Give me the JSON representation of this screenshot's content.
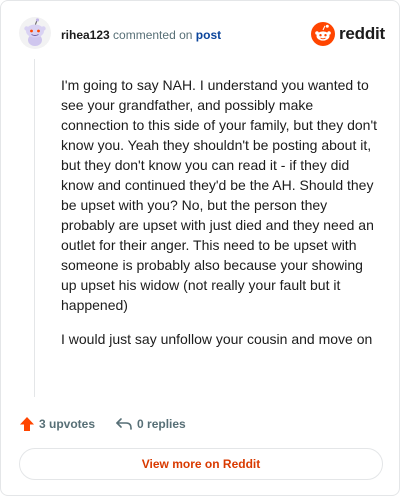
{
  "header": {
    "username": "rihea123",
    "action_text": "commented on",
    "post_link": "post"
  },
  "brand": {
    "name": "reddit",
    "accent": "#ff4500"
  },
  "comment": {
    "paragraphs": [
      "I'm going to say NAH. I understand you wanted to see your grandfather, and possibly make connection to this side of your family, but they don't know you. Yeah they shouldn't be posting about it, but they don't know you can read it - if they did know and continued they'd be the AH. Should they be upset with you? No, but the person they probably are upset with just died and they need an outlet for their anger. This need to be upset with someone is probably also because your showing up upset his widow (not really your fault but it happened)",
      "I would just say unfollow your cousin and move on"
    ]
  },
  "actions": {
    "upvotes": "3 upvotes",
    "replies": "0 replies",
    "upvote_icon": "upvote-arrow-icon",
    "reply_icon": "reply-arrow-icon"
  },
  "footer": {
    "view_more": "View more on Reddit"
  },
  "colors": {
    "upvote": "#ff4500",
    "link": "#0a449b",
    "view_more": "#d93a00",
    "muted": "#576f76"
  }
}
